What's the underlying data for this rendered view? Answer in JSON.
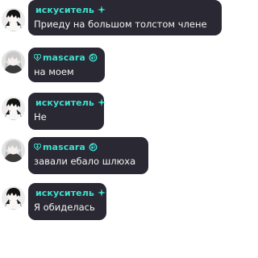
{
  "chat": {
    "messages": [
      {
        "sender": "искуситель",
        "sender_icon": "sparkle-icon",
        "prefix_icon": "",
        "text": "Приеду на большом толстом члене"
      },
      {
        "sender": "mascara",
        "sender_icon": "spiral-badge-icon",
        "prefix_icon": "heart-cross-icon",
        "text": "на моем"
      },
      {
        "sender": "искуситель",
        "sender_icon": "sparkle-icon",
        "prefix_icon": "",
        "text": "Не"
      },
      {
        "sender": "mascara",
        "sender_icon": "spiral-badge-icon",
        "prefix_icon": "heart-cross-icon",
        "text": "завали ебало шлюха"
      },
      {
        "sender": "искуситель",
        "sender_icon": "sparkle-icon",
        "prefix_icon": "",
        "text": "Я обиделась"
      }
    ]
  },
  "colors": {
    "bubble": "#2a2833",
    "sender_name": "#3fe0cf",
    "message_text": "#f4f4f4",
    "background": "#ffffff"
  }
}
